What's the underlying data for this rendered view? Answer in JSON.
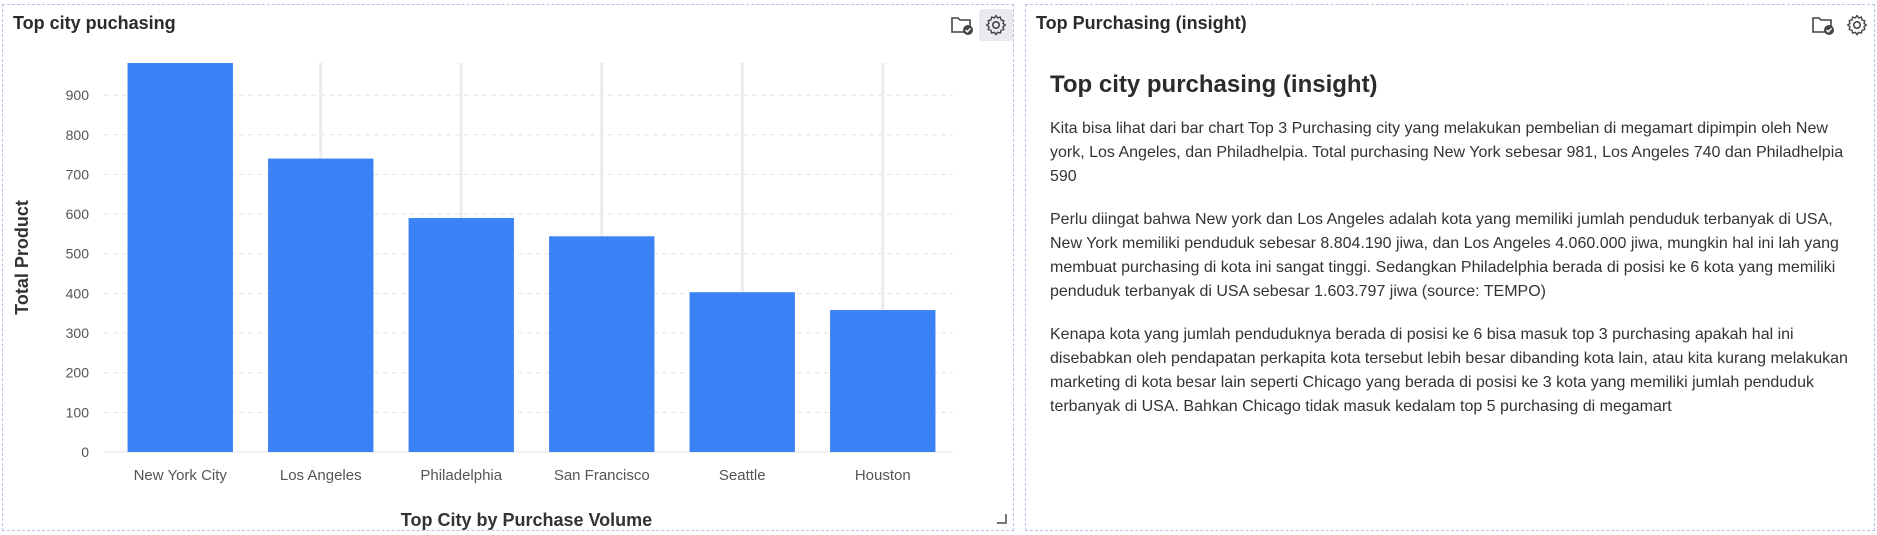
{
  "left_panel": {
    "title": "Top city puchasing",
    "icons": [
      "folder-check-icon",
      "gear-icon"
    ]
  },
  "right_panel": {
    "title": "Top Purchasing (insight)",
    "icons": [
      "folder-check-icon",
      "gear-icon"
    ],
    "insight": {
      "heading": "Top city purchasing (insight)",
      "paragraphs": [
        "Kita bisa lihat dari bar chart Top 3 Purchasing city yang melakukan pembelian di megamart dipimpin oleh New york, Los Angeles, dan Philadhelpia. Total purchasing New York sebesar 981, Los Angeles 740 dan Philadhelpia 590",
        "Perlu diingat bahwa New york dan Los Angeles adalah kota yang memiliki jumlah penduduk terbanyak di USA, New York memiliki penduduk sebesar 8.804.190 jiwa, dan Los Angeles 4.060.000 jiwa, mungkin hal ini lah yang membuat purchasing di kota ini sangat tinggi. Sedangkan Philadelphia berada di posisi ke 6 kota yang memiliki penduduk terbanyak di USA sebesar 1.603.797 jiwa (source: TEMPO)",
        "Kenapa kota yang jumlah penduduknya berada di posisi ke 6 bisa masuk top 3 purchasing apakah hal ini disebabkan oleh pendapatan perkapita kota tersebut lebih besar dibanding kota lain, atau kita kurang melakukan marketing di kota besar lain seperti Chicago yang berada di posisi ke 3 kota yang memiliki jumlah penduduk terbanyak di USA. Bahkan Chicago tidak masuk kedalam top 5 purchasing di megamart"
      ]
    }
  },
  "chart_data": {
    "type": "bar",
    "categories": [
      "New York City",
      "Los Angeles",
      "Philadelphia",
      "San Francisco",
      "Seattle",
      "Houston"
    ],
    "values": [
      981,
      740,
      590,
      544,
      403,
      358
    ],
    "xlabel": "Top City by Purchase Volume",
    "ylabel": "Total Product",
    "ylim": [
      0,
      981
    ],
    "yticks": [
      0,
      100,
      200,
      300,
      400,
      500,
      600,
      700,
      800,
      900
    ],
    "bar_color": "#3b82f6",
    "grid": true
  }
}
